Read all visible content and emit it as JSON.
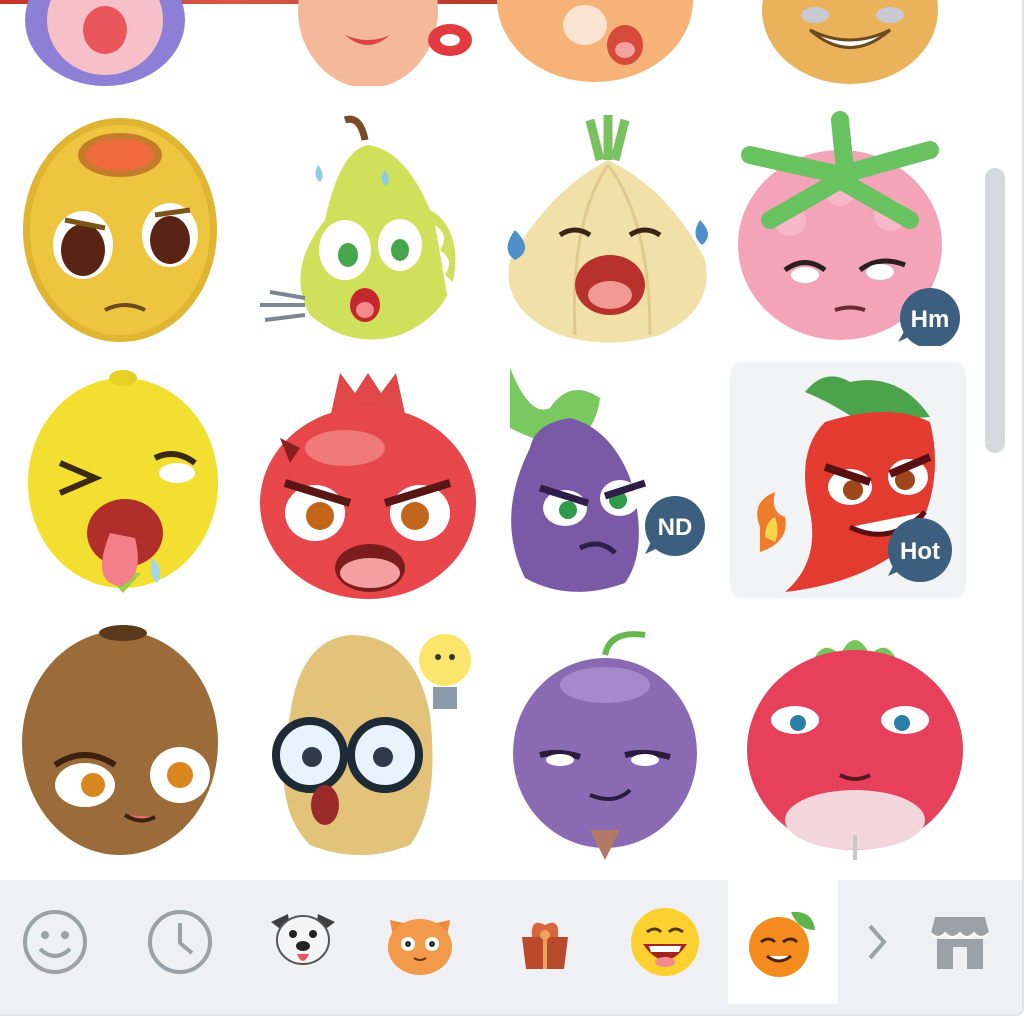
{
  "panel": {
    "title": ""
  },
  "stickers": [
    {
      "name": "sticker-partial-1"
    },
    {
      "name": "sticker-partial-2"
    },
    {
      "name": "sticker-partial-3"
    },
    {
      "name": "sticker-partial-4"
    },
    {
      "name": "sticker-olive"
    },
    {
      "name": "sticker-pear"
    },
    {
      "name": "sticker-onion"
    },
    {
      "name": "sticker-raspberry",
      "bubble": "Hm"
    },
    {
      "name": "sticker-lemon"
    },
    {
      "name": "sticker-pomegranate"
    },
    {
      "name": "sticker-eggplant",
      "bubble": "ND"
    },
    {
      "name": "sticker-chili",
      "bubble": "Hot"
    },
    {
      "name": "sticker-kiwi"
    },
    {
      "name": "sticker-potato"
    },
    {
      "name": "sticker-beet"
    },
    {
      "name": "sticker-radish"
    }
  ],
  "tabs": [
    {
      "name": "emoji-tab",
      "icon": "smiley-icon"
    },
    {
      "name": "recent-tab",
      "icon": "clock-icon"
    },
    {
      "name": "dog-sticker-pack-tab",
      "icon": "dog-icon"
    },
    {
      "name": "cat-sticker-pack-tab",
      "icon": "cat-icon"
    },
    {
      "name": "gift-sticker-pack-tab",
      "icon": "gift-icon"
    },
    {
      "name": "laughing-sticker-pack-tab",
      "icon": "laugh-icon"
    },
    {
      "name": "fruit-sticker-pack-tab",
      "icon": "orange-icon",
      "active": true
    }
  ],
  "nav": {
    "next_icon": "chevron-right-icon",
    "store_icon": "store-icon"
  },
  "colors": {
    "tabbar": "#eef0f3",
    "active_tab": "#ffffff",
    "bubble": "#3c5f7f",
    "icon_gray": "#9aa1a8"
  }
}
